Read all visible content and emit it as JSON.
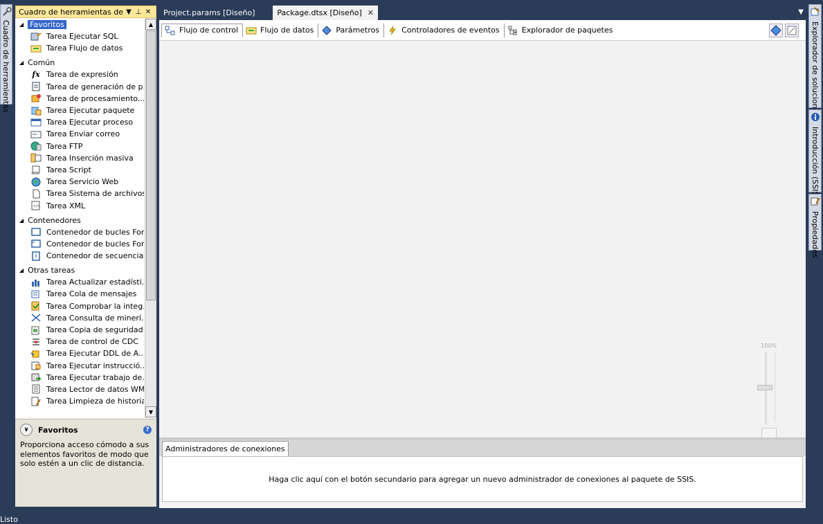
{
  "left_strip": {
    "label": "Cuadro de herramientas"
  },
  "toolbox": {
    "title": "Cuadro de herramientas de...",
    "groups": [
      {
        "label": "Favoritos",
        "items": [
          "Tarea Ejecutar SQL",
          "Tarea Flujo de datos"
        ]
      },
      {
        "label": "Común",
        "items": [
          "Tarea de expresión",
          "Tarea de generación de p...",
          "Tarea de procesamiento...",
          "Tarea Ejecutar paquete",
          "Tarea Ejecutar proceso",
          "Tarea Enviar correo",
          "Tarea FTP",
          "Tarea Inserción masiva",
          "Tarea Script",
          "Tarea Servicio Web",
          "Tarea Sistema de archivos",
          "Tarea XML"
        ]
      },
      {
        "label": "Contenedores",
        "items": [
          "Contenedor de bucles For",
          "Contenedor de bucles For...",
          "Contenedor de secuencias"
        ]
      },
      {
        "label": "Otras tareas",
        "items": [
          "Tarea Actualizar estadísti...",
          "Tarea Cola de mensajes",
          "Tarea Comprobar la integ...",
          "Tarea Consulta de minerí...",
          "Tarea Copia de seguridad...",
          "Tarea de control de CDC",
          "Tarea Ejecutar DDL de A...",
          "Tarea Ejecutar instrucció...",
          "Tarea Ejecutar trabajo de...",
          "Tarea Lector de datos WMI",
          "Tarea Limpieza de historial"
        ]
      }
    ],
    "description": {
      "title": "Favoritos",
      "text": "Proporciona acceso cómodo a sus elementos favoritos de modo que solo estén a un clic de distancia."
    }
  },
  "doc_tabs": [
    "Project.params [Diseño]",
    "Package.dtsx [Diseño]"
  ],
  "designer_tabs": [
    "Flujo de control",
    "Flujo de datos",
    "Parámetros",
    "Controladores de eventos",
    "Explorador de paquetes"
  ],
  "zoom": {
    "label": "100%"
  },
  "connections": {
    "tab": "Administradores de conexiones",
    "hint": "Haga clic aquí con el botón secundario para agregar un nuevo administrador de conexiones al paquete de SSIS."
  },
  "right_strip": [
    "Explorador de soluciones",
    "Introducción (SSIS)",
    "Propiedades"
  ],
  "status": "Listo",
  "colors": {
    "chrome": "#2b3c59",
    "toolbox_header": "#fde79a",
    "selection": "#3366cc"
  }
}
